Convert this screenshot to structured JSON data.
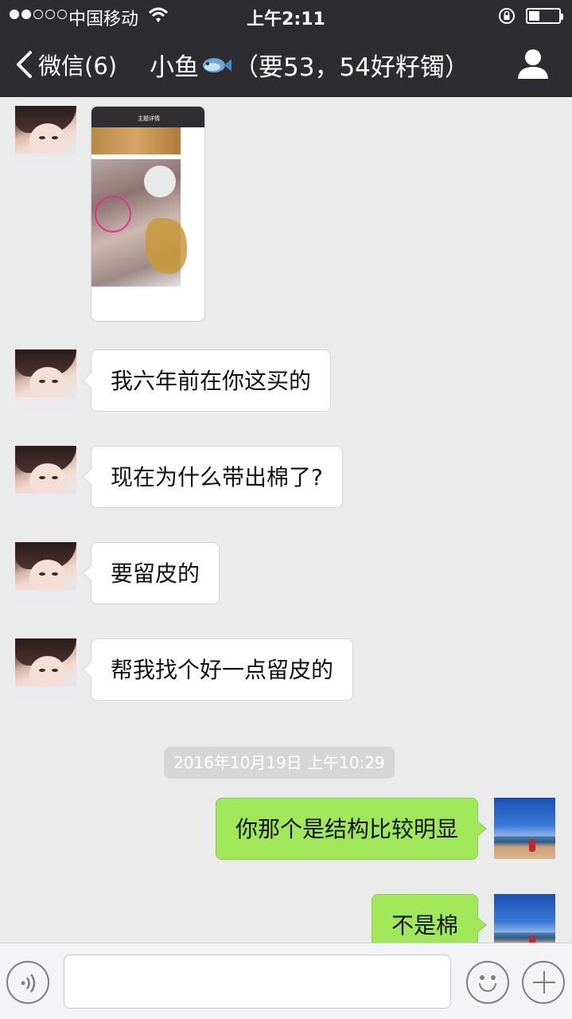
{
  "status_bar": {
    "carrier": "中国移动",
    "time": "上午2:11",
    "battery_level": 0.35
  },
  "nav": {
    "back_label": "微信(6)",
    "title_prefix": "小鱼",
    "title_suffix": "（要53，54好籽镯）",
    "icons": {
      "back": "chevron-left-icon",
      "fish": "fish-emoji-icon",
      "profile": "person-icon"
    }
  },
  "chat": {
    "shared_image": {
      "title": "主题详情"
    },
    "incoming": [
      {
        "text": "我六年前在你这买的"
      },
      {
        "text": "现在为什么带出棉了?"
      },
      {
        "text": "要留皮的"
      },
      {
        "text": "帮我找个好一点留皮的"
      }
    ],
    "timestamp": "2016年10月19日 上午10:29",
    "outgoing": [
      {
        "text": "你那个是结构比较明显"
      },
      {
        "text": "不是棉"
      }
    ]
  },
  "input_bar": {
    "icons": [
      "voice-icon",
      "emoji-icon",
      "plus-icon"
    ]
  },
  "colors": {
    "nav_bg": "#2c2c31",
    "chat_bg": "#ebebeb",
    "outgoing_bubble": "#a0e75a",
    "incoming_bubble": "#ffffff"
  }
}
